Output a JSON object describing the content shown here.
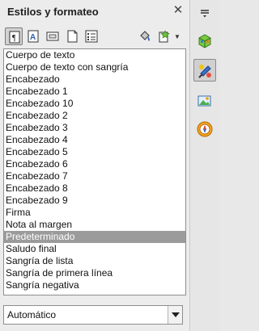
{
  "panel": {
    "title": "Estilos y formateo"
  },
  "toolbar": {
    "buttons": [
      {
        "name": "paragraph-styles-icon",
        "active": true
      },
      {
        "name": "character-styles-icon",
        "active": false
      },
      {
        "name": "frame-styles-icon",
        "active": false
      },
      {
        "name": "page-styles-icon",
        "active": false
      },
      {
        "name": "list-styles-icon",
        "active": false
      },
      {
        "name": "fill-format-mode-icon",
        "active": false
      },
      {
        "name": "new-style-icon",
        "active": false
      }
    ]
  },
  "styles_list": {
    "items": [
      "Cuerpo de texto",
      "Cuerpo de texto con sangría",
      "Encabezado",
      "Encabezado 1",
      "Encabezado 10",
      "Encabezado 2",
      "Encabezado 3",
      "Encabezado 4",
      "Encabezado 5",
      "Encabezado 6",
      "Encabezado 7",
      "Encabezado 8",
      "Encabezado 9",
      "Firma",
      "Nota al margen",
      "Predeterminado",
      "Saludo final",
      "Sangría de lista",
      "Sangría de primera línea",
      "Sangría negativa"
    ],
    "selected": "Predeterminado"
  },
  "filter": {
    "value": "Automático"
  },
  "sidebar": {
    "decks": [
      "properties-icon",
      "styles-icon",
      "gallery-icon",
      "navigator-icon"
    ],
    "active": "styles-icon"
  }
}
